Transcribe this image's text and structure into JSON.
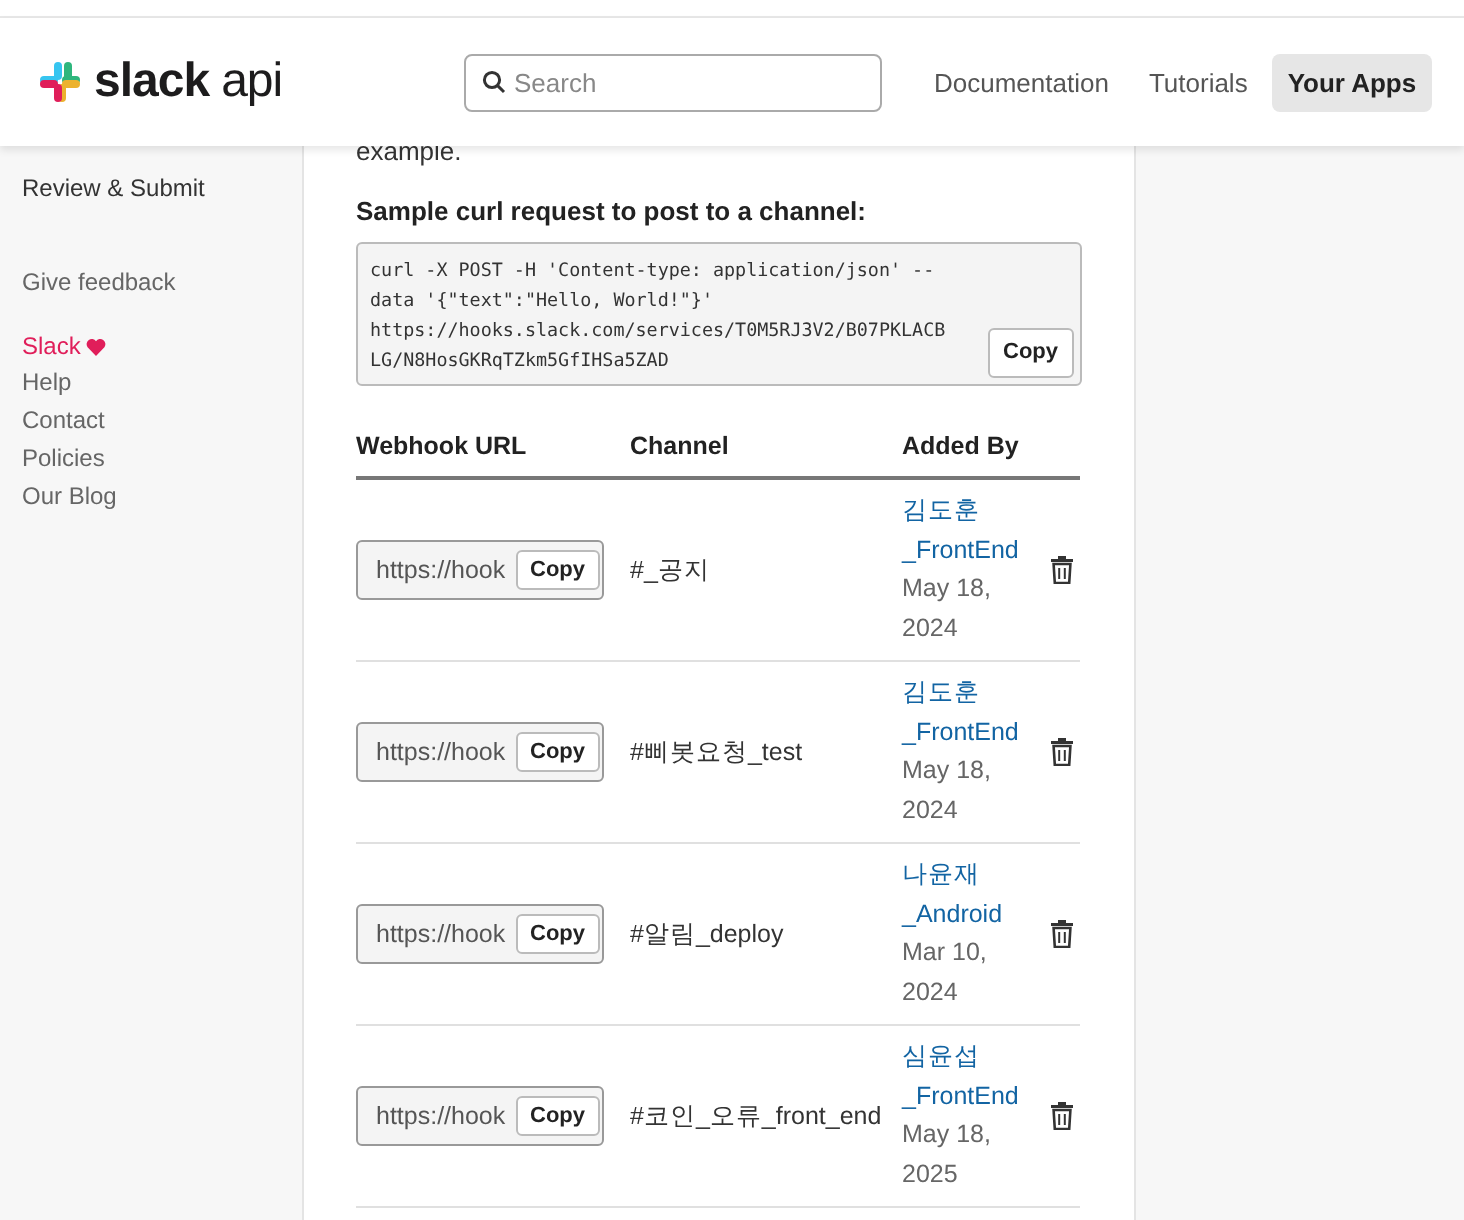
{
  "header": {
    "logo_text": "slack",
    "logo_suffix": "api",
    "search": {
      "placeholder": "Search"
    },
    "nav": [
      {
        "label": "Documentation",
        "selected": false
      },
      {
        "label": "Tutorials",
        "selected": false
      },
      {
        "label": "Your Apps",
        "selected": true
      }
    ]
  },
  "sidebar": {
    "items": [
      "Review & Submit"
    ],
    "feedback": "Give feedback",
    "brand": "Slack",
    "links": [
      "Help",
      "Contact",
      "Policies",
      "Our Blog"
    ]
  },
  "content": {
    "intro_tail": "example.",
    "sample_heading": "Sample curl request to post to a channel:",
    "sample_code": [
      "curl -X POST -H 'Content-type: application/json' --",
      "data '{\"text\":\"Hello, World!\"}'",
      "https://hooks.slack.com/services/T0M5RJ3V2/B07PKLACB",
      "LG/N8HosGKRqTZkm5GfIHSa5ZAD"
    ],
    "sample_copy": "Copy",
    "table": {
      "columns": [
        "Webhook URL",
        "Channel",
        "Added By"
      ],
      "rows": [
        {
          "url": "https://hook",
          "copy": "Copy",
          "channel": "#_공지",
          "user": "김도훈",
          "user_tail": "_FrontEnd",
          "date": "May 18,",
          "year": "2024"
        },
        {
          "url": "https://hook",
          "copy": "Copy",
          "channel": "#삐봇요청_test",
          "user": "김도훈",
          "user_tail": "_FrontEnd",
          "date": "May 18,",
          "year": "2024"
        },
        {
          "url": "https://hook",
          "copy": "Copy",
          "channel": "#알림_deploy",
          "user": "나윤재",
          "user_tail": "_Android",
          "date": "Mar 10,",
          "year": "2024"
        },
        {
          "url": "https://hook",
          "copy": "Copy",
          "channel": "#코인_오류_front_end",
          "user": "심윤섭",
          "user_tail": "_FrontEnd",
          "date": "May 18,",
          "year": "2025"
        }
      ]
    }
  }
}
